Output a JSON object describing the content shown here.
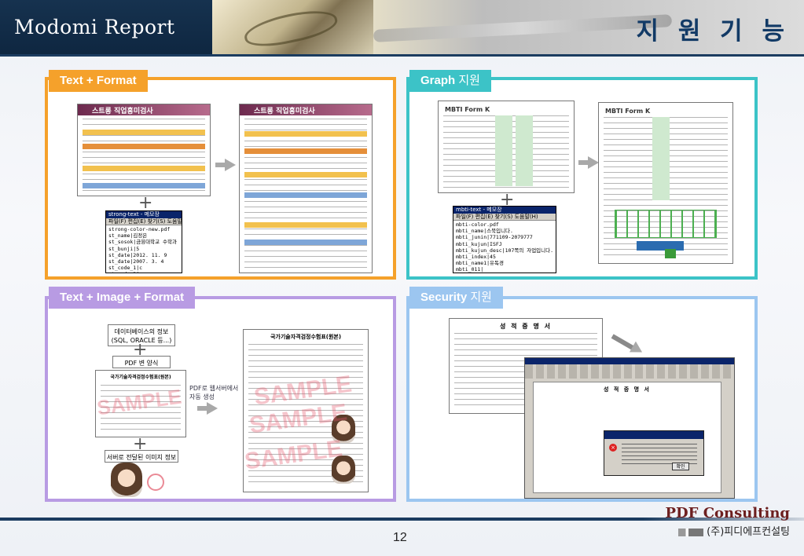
{
  "header": {
    "title": "Modomi Report",
    "right_title": "지 원 기 능"
  },
  "panels": [
    {
      "tab": "Text + Format",
      "tab_extra": ""
    },
    {
      "tab": "Graph",
      "tab_extra": " 지원"
    },
    {
      "tab": "Text + Image + Format",
      "tab_extra": ""
    },
    {
      "tab": "Security",
      "tab_extra": " 지원"
    }
  ],
  "panel1": {
    "doc_header": "스트롱 직업흥미검사",
    "terminal_title": "strong-text - 메모장",
    "terminal_menu": "파일(F)  편집(E)  찾기(S)  도움말",
    "terminal_lines": [
      "strong-color-new.pdf",
      "st_name|김정은",
      "st_sosok|금융대학교 수학과",
      "st_bunji|5",
      "st_date|2012. 11. 9",
      "st_date|2007. 3. 4",
      "st_code_1|c",
      "st_code_2|e",
      "st_code_3|s",
      "st_code_4|e",
      "st_code_5_1|ras|",
      "st_code_5_2|eas|"
    ]
  },
  "panel2": {
    "doc_header": "MBTI Form K",
    "terminal_title": "mbti-text - 메모장",
    "terminal_menu": "파일(F)  편집(E)  찾기(S)  도움말(H)",
    "terminal_lines": [
      "mbti-color.pdf",
      "mbti_name|스북입니다.",
      "mbti_junin|771109-2079777",
      "mbti_kujun|ISFJ",
      "mbti_kujun_desc|107쪽의 자업입니다.",
      "mbti_index|45",
      "mbti_name1|유독경",
      "mbti_011|",
      "mbti_012|",
      "mbti_013|",
      "mbti_014|",
      "mbti_015|"
    ]
  },
  "panel3": {
    "db_box": "데이터베이스의 정보\n(SQL, ORACLE 등...)",
    "format_box": "PDF 변 양식",
    "form_title": "국가기술자격검정수험표(원본)",
    "server_box": "서버로 전달된 이미지 정보",
    "auto_gen": "PDF로 웹서버에서\n자동 생성",
    "right_doc_title": "국가기술자격검정수험표(원본)",
    "sample_text": "SAMPLE"
  },
  "panel4": {
    "cert_title": "성 적 증 명 서",
    "cert_title2": "성 적 증 명 서",
    "ok_label": "확인"
  },
  "footer": {
    "page_number": "12",
    "company_en": "PDF Consulting",
    "company_ko": "(주)피디에프컨설팅"
  },
  "colors": {
    "panel1": "#f5a12b",
    "panel2": "#3cc3c7",
    "panel3": "#b89be3",
    "panel4": "#9cc6f0",
    "header_navy": "#1b3c60"
  }
}
